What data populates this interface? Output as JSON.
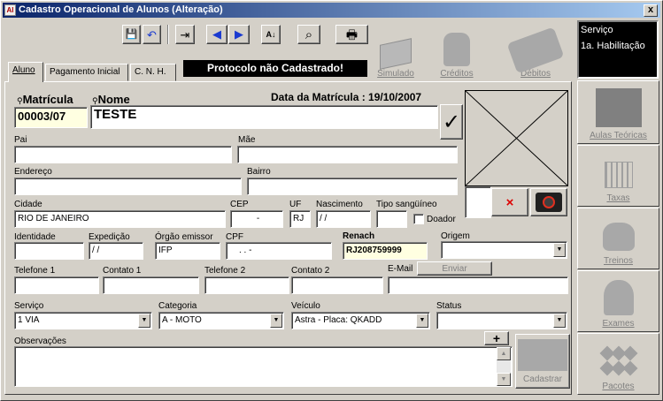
{
  "window": {
    "title": "Cadastro Operacional de Alunos (Alteração)",
    "close_label": "x",
    "app_icon_label": "Al"
  },
  "toolbar": {
    "icons": [
      "save-icon",
      "undo-icon",
      "exit-icon",
      "prev-icon",
      "next-icon",
      "sort-icon",
      "search-icon",
      "print-icon"
    ],
    "save_glyph": "💾",
    "undo_glyph": "↶",
    "exit_glyph": "⇥",
    "prev_glyph": "◀",
    "next_glyph": "▶",
    "sort_glyph": "A↓",
    "search_glyph": "⌕",
    "print_glyph": "🖶",
    "simulado_label": "Simulado",
    "creditos_label": "Créditos",
    "debitos_label": "Débitos"
  },
  "tabs": {
    "aluno": "Aluno",
    "pagamento": "Pagamento Inicial",
    "cnh": "C. N. H."
  },
  "protocol_status": "Protocolo não Cadastrado!",
  "form": {
    "matricula_label": "Matrícula",
    "matricula_value": "00003/07",
    "nome_label": "Nome",
    "nome_value": "TESTE",
    "data_matricula": "Data da Matrícula : 19/10/2007",
    "check_glyph": "✓",
    "pai_label": "Pai",
    "pai_value": "",
    "mae_label": "Mãe",
    "mae_value": "",
    "endereco_label": "Endereço",
    "endereco_value": "",
    "bairro_label": "Bairro",
    "bairro_value": "",
    "cidade_label": "Cidade",
    "cidade_value": "RIO DE JANEIRO",
    "cep_label": "CEP",
    "cep_value": "-",
    "uf_label": "UF",
    "uf_value": "RJ",
    "nascimento_label": "Nascimento",
    "nascimento_value": "/ /",
    "tipo_sanguineo_label": "Tipo sangüíneo",
    "tipo_sanguineo_value": "",
    "doador_label": "Doador",
    "identidade_label": "Identidade",
    "identidade_value": "",
    "expedicao_label": "Expedição",
    "expedicao_value": "/ /",
    "orgao_label": "Órgão emissor",
    "orgao_value": "IFP",
    "cpf_label": "CPF",
    "cpf_value": ". . -",
    "renach_label": "Renach",
    "renach_value": "RJ208759999",
    "origem_label": "Origem",
    "origem_value": "",
    "telefone1_label": "Telefone 1",
    "telefone1_value": "",
    "contato1_label": "Contato 1",
    "contato1_value": "",
    "telefone2_label": "Telefone 2",
    "telefone2_value": "",
    "contato2_label": "Contato 2",
    "contato2_value": "",
    "email_label": "E-Mail",
    "email_value": "",
    "enviar_label": "Enviar",
    "servico_label": "Serviço",
    "servico_value": "1 VIA",
    "categoria_label": "Categoria",
    "categoria_value": "A - MOTO",
    "veiculo_label": "Veículo",
    "veiculo_value": "Astra - Placa: QKADD",
    "status_label": "Status",
    "status_value": "",
    "observacoes_label": "Observações",
    "observacoes_value": "",
    "add_glyph": "+",
    "cadastrar_label": "Cadastrar",
    "delete_photo_glyph": "×"
  },
  "sidebar": {
    "servico_title": "Serviço",
    "servico_value": "1a. Habilitação",
    "aulas_label": "Aulas Teóricas",
    "taxas_label": "Taxas",
    "treinos_label": "Treinos",
    "exames_label": "Exames",
    "pacotes_label": "Pacotes"
  }
}
